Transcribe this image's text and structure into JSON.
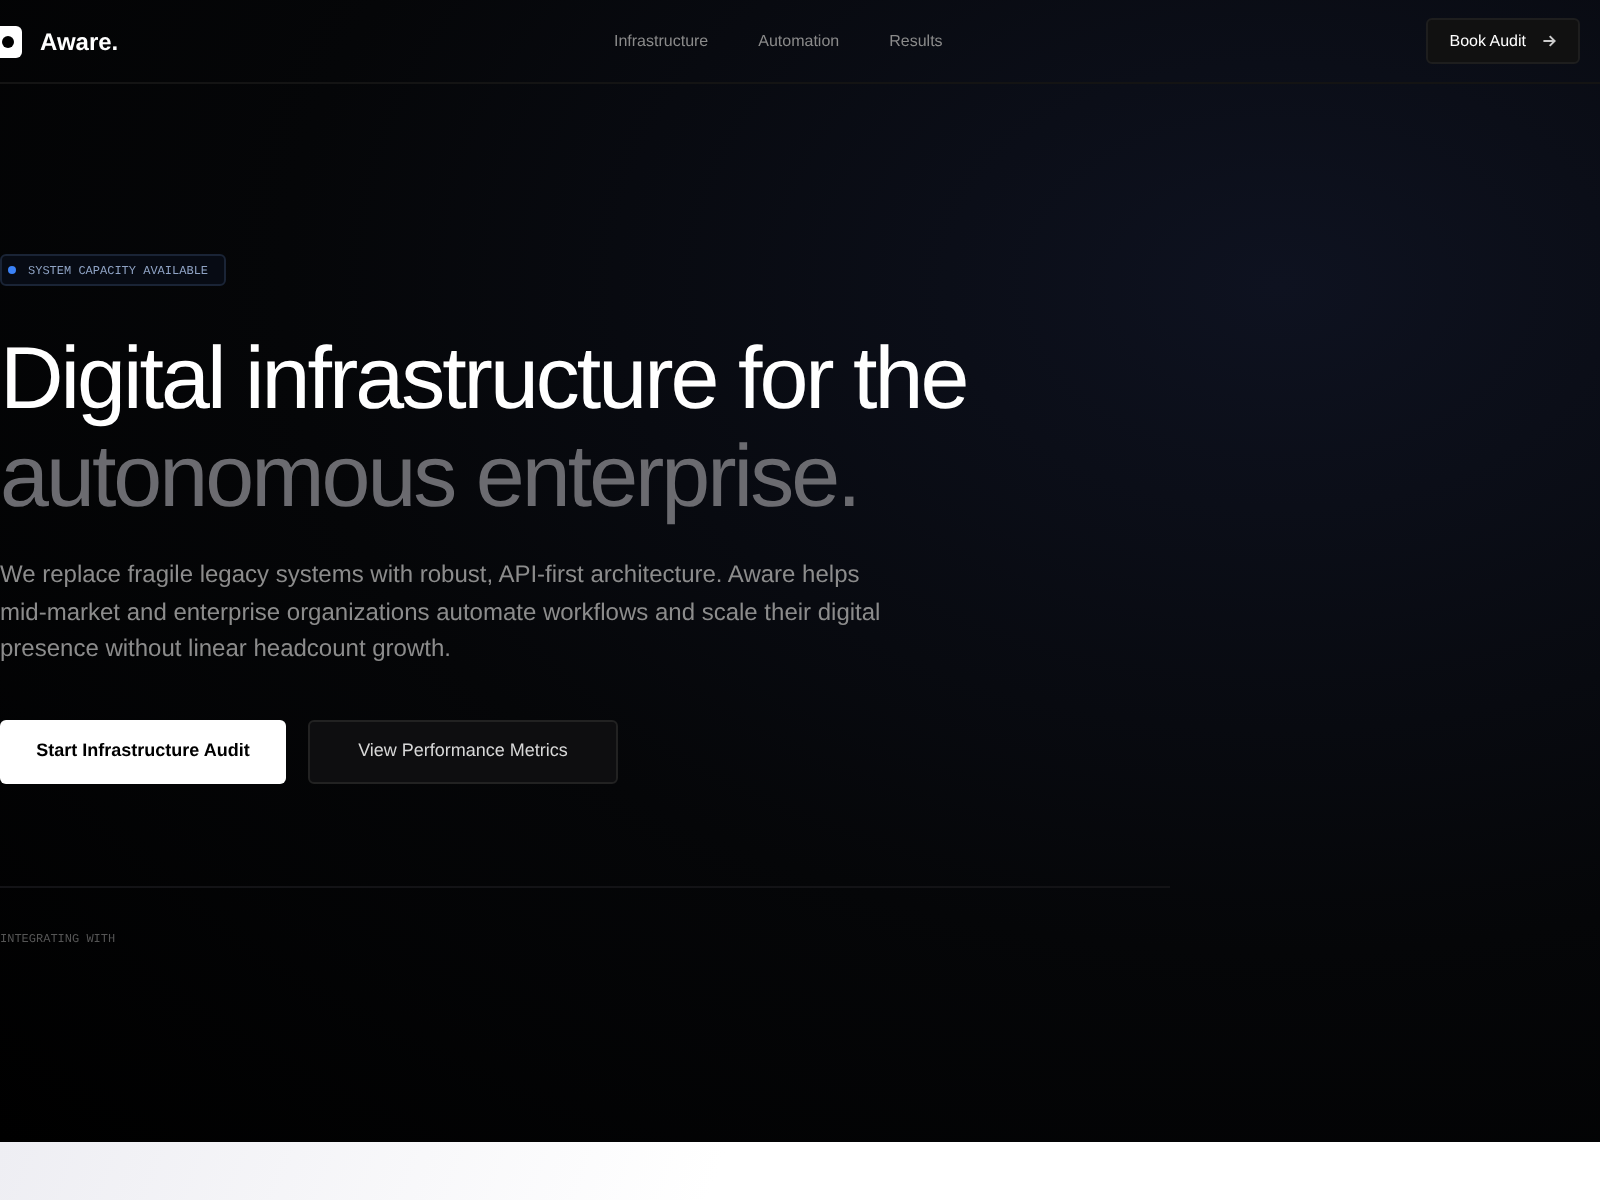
{
  "header": {
    "logo": "Aware.",
    "nav": [
      {
        "label": "Infrastructure"
      },
      {
        "label": "Automation"
      },
      {
        "label": "Results"
      }
    ],
    "cta": "Book Audit"
  },
  "hero": {
    "badge": "SYSTEM CAPACITY AVAILABLE",
    "headline": "Digital infrastructure for the",
    "headline_muted": "autonomous enterprise.",
    "description": "We replace fragile legacy systems with robust, API-first architecture. Aware helps mid-market and enterprise organizations automate workflows and scale their digital presence without linear headcount growth.",
    "buttons": [
      {
        "label": "Start Infrastructure Audit",
        "kind": "primary"
      },
      {
        "label": "View Performance Metrics",
        "kind": "secondary"
      }
    ],
    "integrations_label": "INTEGRATING WITH"
  }
}
